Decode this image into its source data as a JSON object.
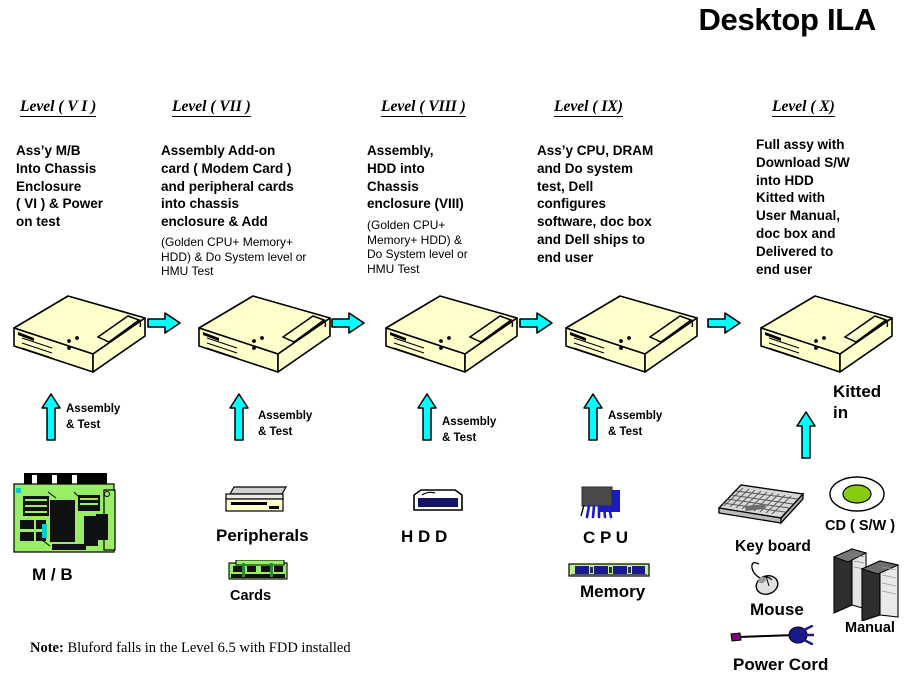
{
  "title": "Desktop ILA",
  "note": {
    "lead": "Note:",
    "text": " Bluford  falls  in the  Level 6.5  with  FDD installed"
  },
  "levels": [
    {
      "header": "Level ( V I )",
      "body": "Ass’y  M/B\nInto Chassis\nEnclosure\n( VI )  & Power\non test",
      "sub": "",
      "assembly_label": "Assembly\n& Test"
    },
    {
      "header": "Level ( VII )",
      "body": "Assembly   Add-on\ncard ( Modem Card )\nand peripheral cards\ninto chassis\nenclosure & Add",
      "sub": "(Golden CPU+ Memory+\nHDD) & Do System level or\nHMU Test",
      "assembly_label": "Assembly\n&  Test"
    },
    {
      "header": "Level ( VIII )",
      "body": "Assembly,\nHDD into\nChassis\nenclosure (VIII)",
      "sub": "(Golden CPU+\nMemory+ HDD) &\nDo System level or\nHMU Test",
      "assembly_label": "Assembly\n& Test"
    },
    {
      "header": "Level ( IX)",
      "body": "Ass’y  CPU, DRAM\nand  Do  system\ntest, Dell\nconfigures\nsoftware,  doc box\nand Dell ships to\nend user",
      "sub": "",
      "assembly_label": "Assembly\n& Test"
    },
    {
      "header": "Level  ( X)",
      "body": "Full assy with\nDownload  S/W\ninto HDD\nKitted with\nUser Manual,\ndoc box and\nDelivered to\nend user",
      "sub": "",
      "assembly_label": "Kitted\nin"
    }
  ],
  "components": {
    "motherboard": "M / B",
    "peripherals": "Peripherals",
    "cards": "Cards",
    "hdd": "H D D",
    "cpu": "C P U",
    "memory": "Memory",
    "keyboard": "Key board",
    "mouse": "Mouse",
    "power_cord": "Power  Cord",
    "cd": "CD ( S/W )",
    "manual": "Manual"
  },
  "colors": {
    "chassis_fill": "#FFFFCC",
    "arrow_fill": "#00FFFF",
    "pcb_green": "#99EE66",
    "hdd_blue": "#141464",
    "cd_green": "#88CC11",
    "outline": "#000000"
  }
}
